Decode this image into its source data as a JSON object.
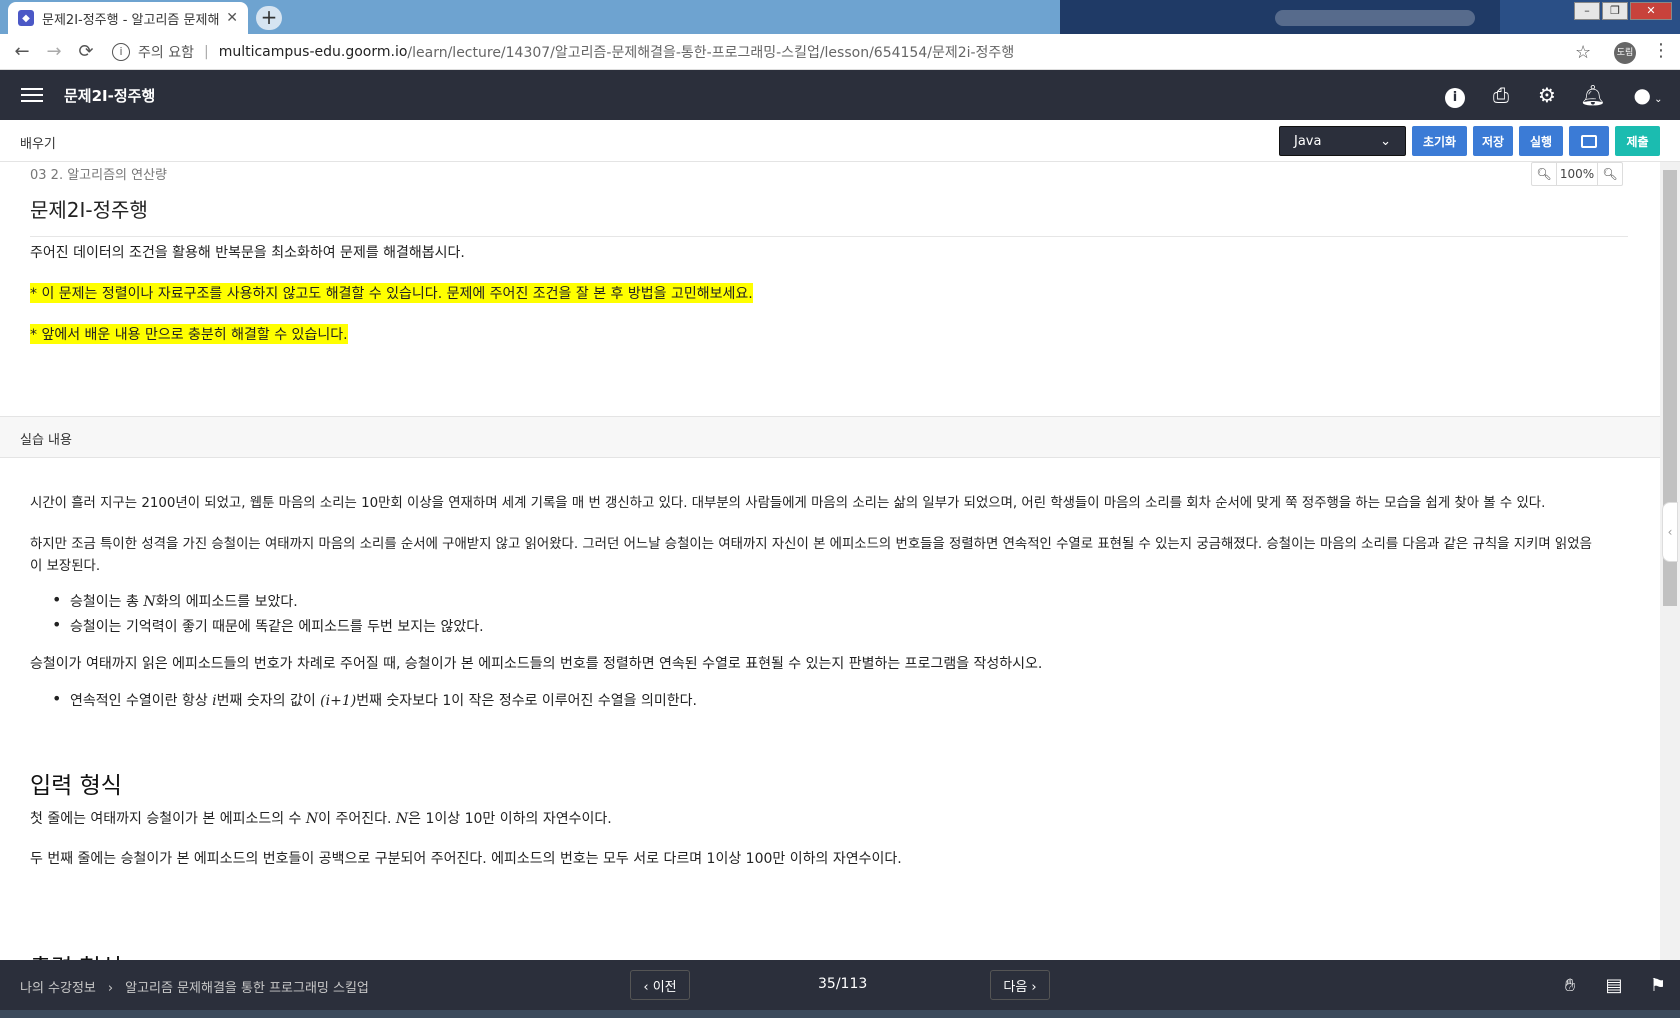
{
  "browser": {
    "tab_title": "문제2I-정주행 - 알고리즘 문제해",
    "new_tab": "+",
    "security_label": "주의 요함",
    "url_host": "multicampus-edu.goorm.io",
    "url_path": "/learn/lecture/14307/알고리즘-문제해결을-통한-프로그래밍-스킬업/lesson/654154/문제2i-정주행",
    "profile_initials": "도림"
  },
  "header": {
    "title": "문제2I-정주행",
    "icons": [
      "info-icon",
      "print-icon",
      "gear-icon",
      "bell-icon",
      "user-icon"
    ]
  },
  "toolbar": {
    "label": "배우기",
    "language": "Java",
    "buttons": {
      "reset": "초기화",
      "save": "저장",
      "run": "실행",
      "submit": "제출"
    }
  },
  "content": {
    "breadcrumb": "03 2. 알고리즘의 연산량",
    "zoom": "100%",
    "title": "문제2I-정주행",
    "intro": "주어진 데이터의 조건을 활용해 반복문을 최소화하여 문제를 해결해봅시다.",
    "note1": " * 이 문제는 정렬이나 자료구조를  사용하지 않고도 해결할 수 있습니다. 문제에 주어진 조건을 잘 본 후 방법을 고민해보세요.",
    "note2": "* 앞에서 배운 내용 만으로 충분히 해결할 수 있습니다.",
    "section_label": "실습 내용",
    "para1": " 시간이 흘러 지구는 2100년이 되었고, 웹툰 마음의 소리는 10만회 이상을 연재하며 세계 기록을 매 번 갱신하고 있다. 대부분의 사람들에게 마음의 소리는 삶의 일부가 되었으며, 어린 학생들이 마음의 소리를 회차 순서에 맞게 쭉 정주행을 하는 모습을 쉽게 찾아 볼 수 있다.",
    "para2a": " 하지만 조금 특이한 성격을 가진 승철이는 여태까지 마음의 소리를 순서에 구애받지 않고 읽어왔다. 그러던 어느날 승철이는 여태까지 자신이 본 에피소드의 번호들을 정렬하면 연속적인 수열로 표현될 수 있는지 궁금해졌다. 승철이는 마음의 소리를 다음과 같은 규칙을 지키며 읽었음",
    "para2b": "이 보장된다.",
    "bullet1_pre": "승철이는 총 ",
    "bullet1_var": "N",
    "bullet1_post": "화의 에피소드를 보았다.",
    "bullet2": "승철이는 기억력이 좋기 때문에 똑같은 에피소드를 두번 보지는 않았다.",
    "para3": " 승철이가 여태까지 읽은 에피소드들의 번호가 차례로 주어질 때, 승철이가 본 에피소드들의 번호를 정렬하면 연속된 수열로 표현될 수 있는지 판별하는 프로그램을 작성하시오.",
    "bullet3_pre": " 연속적인 수열이란 항상 ",
    "bullet3_var1": "i",
    "bullet3_mid": "번째 숫자의 값이 ",
    "bullet3_var2": "(i+1)",
    "bullet3_post": "번째 숫자보다 1이 작은 정수로 이루어진 수열을 의미한다.",
    "input_heading": "입력 형식",
    "input1_pre": " 첫 줄에는 여태까지 승철이가 본 에피소드의 수 ",
    "input1_var1": "N",
    "input1_mid": "이 주어진다. ",
    "input1_var2": "N",
    "input1_post": "은 1이상 10만 이하의 자연수이다.",
    "input2": "두 번째 줄에는 승철이가 본 에피소드의 번호들이 공백으로 구분되어 주어진다. 에피소드의 번호는 모두 서로 다르며 1이상 100만 이하의 자연수이다.",
    "output_heading": "출력 형식"
  },
  "footer": {
    "crumb1": "나의 수강정보",
    "crumb_arrow": "›",
    "crumb2": "알고리즘 문제해결을 통한 프로그래밍 스킬업",
    "prev": "‹ 이전",
    "pager": "35/113",
    "next": "다음 ›"
  }
}
